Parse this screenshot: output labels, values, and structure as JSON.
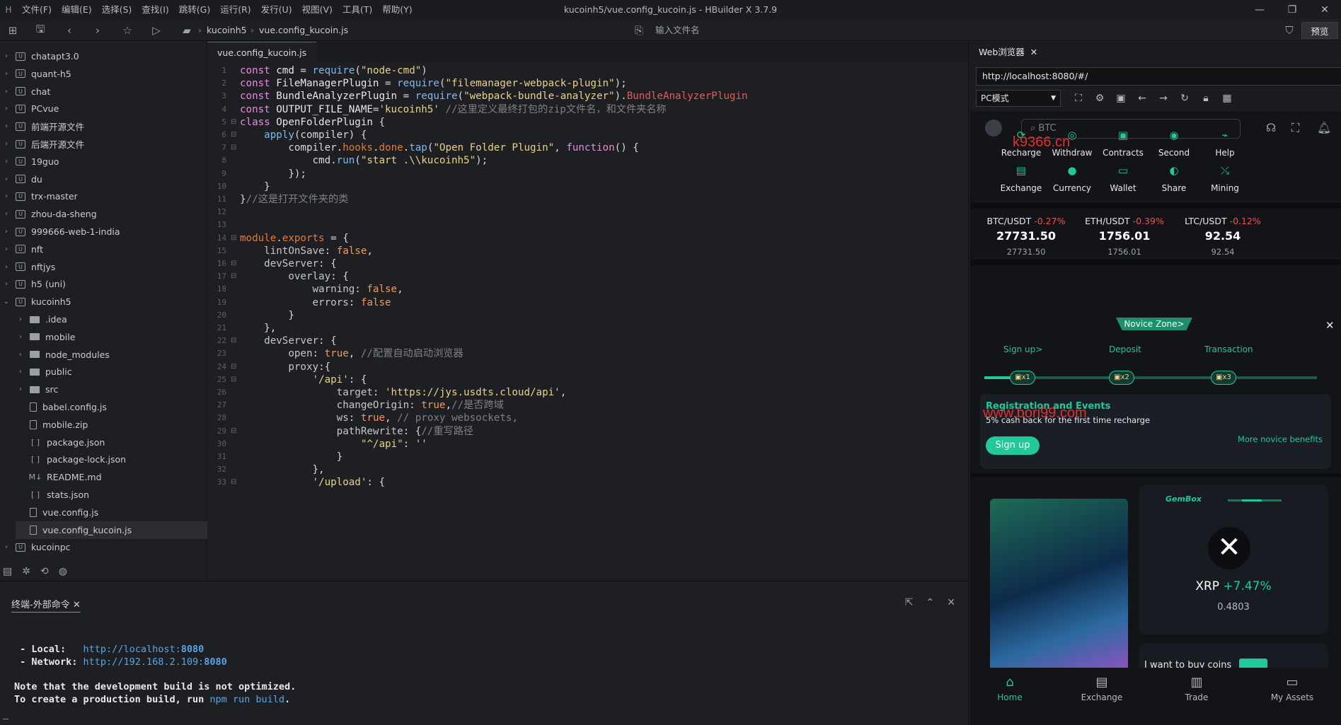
{
  "menubar": {
    "items": [
      "文件(F)",
      "编辑(E)",
      "选择(S)",
      "查找(I)",
      "跳转(G)",
      "运行(R)",
      "发行(U)",
      "视图(V)",
      "工具(T)",
      "帮助(Y)"
    ],
    "window_title": "kucoinh5/vue.config_kucoin.js - HBuilder X 3.7.9",
    "minimize": "—",
    "maximize": "❐",
    "close": "✕"
  },
  "toolbar": {
    "crumbs": [
      "kucoinh5",
      "vue.config_kucoin.js"
    ],
    "input_file_label": "输入文件名",
    "preview_label": "预览"
  },
  "explorer": {
    "items": [
      {
        "label": "chatapt3.0",
        "type": "project",
        "chev": "›"
      },
      {
        "label": "quant-h5",
        "type": "project",
        "chev": "›"
      },
      {
        "label": "chat",
        "type": "project",
        "chev": "›"
      },
      {
        "label": "PCvue",
        "type": "project",
        "chev": "›"
      },
      {
        "label": "前端开源文件",
        "type": "project",
        "chev": "›"
      },
      {
        "label": "后端开源文件",
        "type": "project",
        "chev": "›"
      },
      {
        "label": "19guo",
        "type": "project",
        "chev": "›"
      },
      {
        "label": "du",
        "type": "project",
        "chev": "›"
      },
      {
        "label": "trx-master",
        "type": "project",
        "chev": "›"
      },
      {
        "label": "zhou-da-sheng",
        "type": "project",
        "chev": "›"
      },
      {
        "label": "999666-web-1-india",
        "type": "project",
        "chev": "›"
      },
      {
        "label": "nft",
        "type": "project",
        "chev": "›"
      },
      {
        "label": "nftjys",
        "type": "project",
        "chev": "›"
      },
      {
        "label": "h5 (uni)",
        "type": "project",
        "chev": "›"
      },
      {
        "label": "kucoinh5",
        "type": "project",
        "chev": "⌄"
      },
      {
        "label": ".idea",
        "type": "folder",
        "chev": "›"
      },
      {
        "label": "mobile",
        "type": "folder",
        "chev": "›"
      },
      {
        "label": "node_modules",
        "type": "folder",
        "chev": "›"
      },
      {
        "label": "public",
        "type": "folder",
        "chev": "›"
      },
      {
        "label": "src",
        "type": "folder",
        "chev": "›"
      },
      {
        "label": "babel.config.js",
        "type": "file",
        "chev": ""
      },
      {
        "label": "mobile.zip",
        "type": "file",
        "chev": ""
      },
      {
        "label": "package.json",
        "type": "json",
        "chev": ""
      },
      {
        "label": "package-lock.json",
        "type": "json",
        "chev": ""
      },
      {
        "label": "README.md",
        "type": "md",
        "chev": ""
      },
      {
        "label": "stats.json",
        "type": "json",
        "chev": ""
      },
      {
        "label": "vue.config.js",
        "type": "file",
        "chev": ""
      },
      {
        "label": "vue.config_kucoin.js",
        "type": "file",
        "chev": "",
        "selected": true
      },
      {
        "label": "kucoinpc",
        "type": "project",
        "chev": "›"
      }
    ]
  },
  "editor": {
    "tab_label": "vue.config_kucoin.js",
    "lines": [
      {
        "n": "1",
        "fold": "",
        "t": [
          [
            "k",
            "const "
          ],
          [
            "v",
            "cmd "
          ],
          [
            "p",
            "= "
          ],
          [
            "f",
            "require"
          ],
          [
            "p",
            "("
          ],
          [
            "s",
            "\"node-cmd\""
          ],
          [
            "p",
            ")"
          ]
        ]
      },
      {
        "n": "2",
        "fold": "",
        "t": [
          [
            "k",
            "const "
          ],
          [
            "v",
            "FileManagerPlugin "
          ],
          [
            "p",
            "= "
          ],
          [
            "f",
            "require"
          ],
          [
            "p",
            "("
          ],
          [
            "s",
            "\"filemanager-webpack-plugin\""
          ],
          [
            "p",
            ");"
          ]
        ]
      },
      {
        "n": "3",
        "fold": "",
        "t": [
          [
            "k",
            "const "
          ],
          [
            "v",
            "BundleAnalyzerPlugin "
          ],
          [
            "p",
            "= "
          ],
          [
            "f",
            "require"
          ],
          [
            "p",
            "("
          ],
          [
            "s",
            "\"webpack-bundle-analyzer\""
          ],
          [
            "p",
            ")."
          ],
          [
            "r",
            "BundleAnalyzerPlugin"
          ]
        ]
      },
      {
        "n": "4",
        "fold": "",
        "t": [
          [
            "k",
            "const "
          ],
          [
            "v",
            "OUTPUT_FILE_NAME"
          ],
          [
            "p",
            "="
          ],
          [
            "s",
            "'kucoinh5'"
          ],
          [
            "c",
            " //这里定义最终打包的zip文件名，和文件夹名称"
          ]
        ]
      },
      {
        "n": "5",
        "fold": "⊟",
        "t": [
          [
            "k",
            "class "
          ],
          [
            "v",
            "OpenFolderPlugin "
          ],
          [
            "p",
            "{"
          ]
        ]
      },
      {
        "n": "6",
        "fold": "⊟",
        "t": [
          [
            "p",
            "    "
          ],
          [
            "f",
            "apply"
          ],
          [
            "p",
            "(compiler) {"
          ]
        ]
      },
      {
        "n": "7",
        "fold": "⊟",
        "t": [
          [
            "p",
            "        compiler."
          ],
          [
            "o",
            "hooks"
          ],
          [
            "p",
            "."
          ],
          [
            "o",
            "done"
          ],
          [
            "p",
            "."
          ],
          [
            "f",
            "tap"
          ],
          [
            "p",
            "("
          ],
          [
            "s",
            "\"Open Folder Plugin\""
          ],
          [
            "p",
            ", "
          ],
          [
            "k",
            "function"
          ],
          [
            "p",
            "() {"
          ]
        ]
      },
      {
        "n": "8",
        "fold": "",
        "t": [
          [
            "p",
            "            cmd."
          ],
          [
            "f",
            "run"
          ],
          [
            "p",
            "("
          ],
          [
            "s",
            "\"start .\\\\kucoinh5\""
          ],
          [
            "p",
            ");"
          ]
        ]
      },
      {
        "n": "9",
        "fold": "",
        "t": [
          [
            "p",
            "        });"
          ]
        ]
      },
      {
        "n": "10",
        "fold": "",
        "t": [
          [
            "p",
            "    }"
          ]
        ]
      },
      {
        "n": "11",
        "fold": "",
        "t": [
          [
            "p",
            "}"
          ],
          [
            "c",
            "//这是打开文件夹的类"
          ]
        ]
      },
      {
        "n": "12",
        "fold": "",
        "t": [
          [
            "p",
            ""
          ]
        ]
      },
      {
        "n": "13",
        "fold": "",
        "t": [
          [
            "p",
            ""
          ]
        ]
      },
      {
        "n": "14",
        "fold": "⊟",
        "t": [
          [
            "o",
            "module"
          ],
          [
            "p",
            "."
          ],
          [
            "o",
            "exports "
          ],
          [
            "p",
            "= {"
          ]
        ]
      },
      {
        "n": "15",
        "fold": "",
        "t": [
          [
            "p",
            "    "
          ],
          [
            "pr",
            "lintOnSave"
          ],
          [
            "p",
            ": "
          ],
          [
            "n",
            "false"
          ],
          [
            "p",
            ","
          ]
        ]
      },
      {
        "n": "16",
        "fold": "⊟",
        "t": [
          [
            "p",
            "    "
          ],
          [
            "pr",
            "devServer"
          ],
          [
            "p",
            ": {"
          ]
        ]
      },
      {
        "n": "17",
        "fold": "⊟",
        "t": [
          [
            "p",
            "        "
          ],
          [
            "pr",
            "overlay"
          ],
          [
            "p",
            ": {"
          ]
        ]
      },
      {
        "n": "18",
        "fold": "",
        "t": [
          [
            "p",
            "            "
          ],
          [
            "pr",
            "warning"
          ],
          [
            "p",
            ": "
          ],
          [
            "n",
            "false"
          ],
          [
            "p",
            ","
          ]
        ]
      },
      {
        "n": "19",
        "fold": "",
        "t": [
          [
            "p",
            "            "
          ],
          [
            "pr",
            "errors"
          ],
          [
            "p",
            ": "
          ],
          [
            "n",
            "false"
          ]
        ]
      },
      {
        "n": "20",
        "fold": "",
        "t": [
          [
            "p",
            "        }"
          ]
        ]
      },
      {
        "n": "21",
        "fold": "",
        "t": [
          [
            "p",
            "    },"
          ]
        ]
      },
      {
        "n": "22",
        "fold": "⊟",
        "t": [
          [
            "p",
            "    "
          ],
          [
            "pr",
            "devServer"
          ],
          [
            "p",
            ": {"
          ]
        ]
      },
      {
        "n": "23",
        "fold": "",
        "t": [
          [
            "p",
            "        "
          ],
          [
            "pr",
            "open"
          ],
          [
            "p",
            ": "
          ],
          [
            "n",
            "true"
          ],
          [
            "p",
            ", "
          ],
          [
            "c",
            "//配置自动启动浏览器"
          ]
        ]
      },
      {
        "n": "24",
        "fold": "⊟",
        "t": [
          [
            "p",
            "        "
          ],
          [
            "pr",
            "proxy"
          ],
          [
            "p",
            ":{"
          ]
        ]
      },
      {
        "n": "25",
        "fold": "⊟",
        "t": [
          [
            "p",
            "            "
          ],
          [
            "s",
            "'/api'"
          ],
          [
            "p",
            ": {"
          ]
        ]
      },
      {
        "n": "26",
        "fold": "",
        "t": [
          [
            "p",
            "                "
          ],
          [
            "pr",
            "target"
          ],
          [
            "p",
            ": "
          ],
          [
            "s",
            "'https://jys.usdts.cloud/api'"
          ],
          [
            "p",
            ","
          ]
        ]
      },
      {
        "n": "27",
        "fold": "",
        "t": [
          [
            "p",
            "                "
          ],
          [
            "pr",
            "changeOrigin"
          ],
          [
            "p",
            ": "
          ],
          [
            "n",
            "true"
          ],
          [
            "p",
            ","
          ],
          [
            "c",
            "//是否跨域"
          ]
        ]
      },
      {
        "n": "28",
        "fold": "",
        "t": [
          [
            "p",
            "                "
          ],
          [
            "pr",
            "ws"
          ],
          [
            "p",
            ": "
          ],
          [
            "n",
            "true"
          ],
          [
            "p",
            ", "
          ],
          [
            "c",
            "// proxy websockets,"
          ]
        ]
      },
      {
        "n": "29",
        "fold": "⊟",
        "t": [
          [
            "p",
            "                "
          ],
          [
            "pr",
            "pathRewrite"
          ],
          [
            "p",
            ": {"
          ],
          [
            "c",
            "//重写路径"
          ]
        ]
      },
      {
        "n": "30",
        "fold": "",
        "t": [
          [
            "p",
            "                    "
          ],
          [
            "s",
            "\"^/api\""
          ],
          [
            "p",
            ": "
          ],
          [
            "s",
            "''"
          ]
        ]
      },
      {
        "n": "31",
        "fold": "",
        "t": [
          [
            "p",
            "                }"
          ]
        ]
      },
      {
        "n": "32",
        "fold": "",
        "t": [
          [
            "p",
            "            },"
          ]
        ]
      },
      {
        "n": "33",
        "fold": "⊟",
        "t": [
          [
            "p",
            "            "
          ],
          [
            "s",
            "'/upload'"
          ],
          [
            "p",
            ": {"
          ]
        ]
      }
    ]
  },
  "terminal": {
    "tab_label": "终端-外部命令",
    "local_label": " - Local:   ",
    "local_url": "http://localhost:",
    "local_port": "8080",
    "network_label": " - Network: ",
    "network_url": "http://192.168.2.109:",
    "network_port": "8080",
    "note1": "Note that the development build is not optimized.",
    "note2_pre": "To create a production build, run ",
    "note2_cmd": "npm run build",
    "note2_post": ".",
    "cursor": "_"
  },
  "browser": {
    "tab_label": "Web浏览器",
    "url": "http://localhost:8080/#/",
    "mode": "PC模式"
  },
  "app": {
    "search_placeholder": "BTC",
    "grid": [
      {
        "label": "Recharge",
        "icon": "recharge-icon",
        "glyph": "⟳"
      },
      {
        "label": "Withdraw",
        "icon": "kcs-icon",
        "glyph": "◎"
      },
      {
        "label": "Contracts",
        "icon": "contracts-icon",
        "glyph": "▣"
      },
      {
        "label": "Second",
        "icon": "second-icon",
        "glyph": "◉"
      },
      {
        "label": "Help",
        "icon": "help-icon",
        "glyph": "⌁"
      },
      {
        "label": "Exchange",
        "icon": "exchange-icon",
        "glyph": "▤"
      },
      {
        "label": "Currency",
        "icon": "currency-icon",
        "glyph": "●"
      },
      {
        "label": "Wallet",
        "icon": "wallet-icon",
        "glyph": "▭"
      },
      {
        "label": "Share",
        "icon": "share-icon",
        "glyph": "◐"
      },
      {
        "label": "Mining",
        "icon": "mining-icon",
        "glyph": "⤯"
      }
    ],
    "tickers": [
      {
        "pair": "BTC/USDT",
        "change": "-0.27%",
        "price": "27731.50",
        "sub": "27731.50"
      },
      {
        "pair": "ETH/USDT",
        "change": "-0.39%",
        "price": "1756.01",
        "sub": "1756.01"
      },
      {
        "pair": "LTC/USDT",
        "change": "-0.12%",
        "price": "92.54",
        "sub": "92.54"
      }
    ],
    "novice_zone": "Novice Zone>",
    "steps": [
      "Sign up>",
      "Deposit",
      "Transaction"
    ],
    "nodes": [
      "x1",
      "x2",
      "x3"
    ],
    "reg_title": "Registration and Events",
    "reg_sub": "5% cash back for the first time recharge",
    "signup": "Sign up",
    "more_benefits": "More novice benefits",
    "gembox": "GemBox",
    "coin_name": "XRP",
    "coin_change": "+7.47%",
    "coin_price": "0.4803",
    "buy_coins": "I want to buy coins",
    "watermark1": "k9366.cn",
    "watermark2": "www.bori99.com",
    "bottom_nav": [
      "Home",
      "Exchange",
      "Trade",
      "My Assets"
    ],
    "accent": "#20c997"
  }
}
